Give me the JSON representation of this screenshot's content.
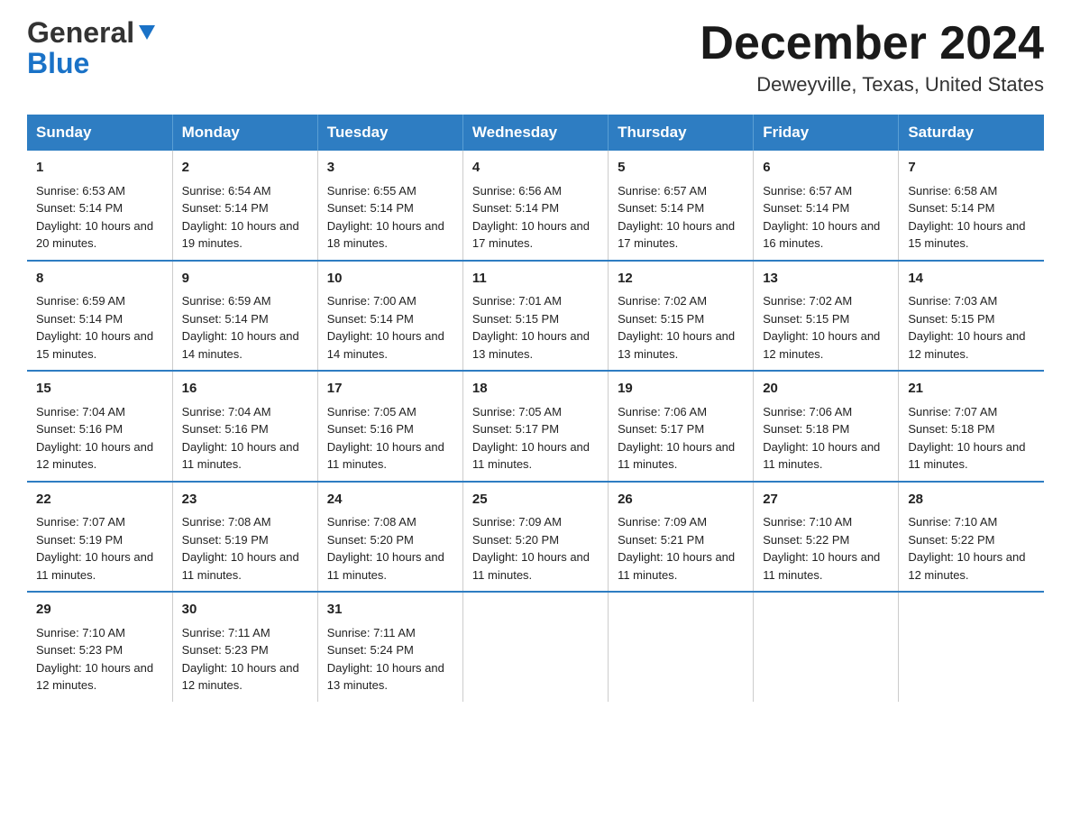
{
  "header": {
    "logo_general": "General",
    "logo_blue": "Blue",
    "title": "December 2024",
    "subtitle": "Deweyville, Texas, United States"
  },
  "days_of_week": [
    "Sunday",
    "Monday",
    "Tuesday",
    "Wednesday",
    "Thursday",
    "Friday",
    "Saturday"
  ],
  "weeks": [
    [
      {
        "day": "1",
        "sunrise": "6:53 AM",
        "sunset": "5:14 PM",
        "daylight": "10 hours and 20 minutes."
      },
      {
        "day": "2",
        "sunrise": "6:54 AM",
        "sunset": "5:14 PM",
        "daylight": "10 hours and 19 minutes."
      },
      {
        "day": "3",
        "sunrise": "6:55 AM",
        "sunset": "5:14 PM",
        "daylight": "10 hours and 18 minutes."
      },
      {
        "day": "4",
        "sunrise": "6:56 AM",
        "sunset": "5:14 PM",
        "daylight": "10 hours and 17 minutes."
      },
      {
        "day": "5",
        "sunrise": "6:57 AM",
        "sunset": "5:14 PM",
        "daylight": "10 hours and 17 minutes."
      },
      {
        "day": "6",
        "sunrise": "6:57 AM",
        "sunset": "5:14 PM",
        "daylight": "10 hours and 16 minutes."
      },
      {
        "day": "7",
        "sunrise": "6:58 AM",
        "sunset": "5:14 PM",
        "daylight": "10 hours and 15 minutes."
      }
    ],
    [
      {
        "day": "8",
        "sunrise": "6:59 AM",
        "sunset": "5:14 PM",
        "daylight": "10 hours and 15 minutes."
      },
      {
        "day": "9",
        "sunrise": "6:59 AM",
        "sunset": "5:14 PM",
        "daylight": "10 hours and 14 minutes."
      },
      {
        "day": "10",
        "sunrise": "7:00 AM",
        "sunset": "5:14 PM",
        "daylight": "10 hours and 14 minutes."
      },
      {
        "day": "11",
        "sunrise": "7:01 AM",
        "sunset": "5:15 PM",
        "daylight": "10 hours and 13 minutes."
      },
      {
        "day": "12",
        "sunrise": "7:02 AM",
        "sunset": "5:15 PM",
        "daylight": "10 hours and 13 minutes."
      },
      {
        "day": "13",
        "sunrise": "7:02 AM",
        "sunset": "5:15 PM",
        "daylight": "10 hours and 12 minutes."
      },
      {
        "day": "14",
        "sunrise": "7:03 AM",
        "sunset": "5:15 PM",
        "daylight": "10 hours and 12 minutes."
      }
    ],
    [
      {
        "day": "15",
        "sunrise": "7:04 AM",
        "sunset": "5:16 PM",
        "daylight": "10 hours and 12 minutes."
      },
      {
        "day": "16",
        "sunrise": "7:04 AM",
        "sunset": "5:16 PM",
        "daylight": "10 hours and 11 minutes."
      },
      {
        "day": "17",
        "sunrise": "7:05 AM",
        "sunset": "5:16 PM",
        "daylight": "10 hours and 11 minutes."
      },
      {
        "day": "18",
        "sunrise": "7:05 AM",
        "sunset": "5:17 PM",
        "daylight": "10 hours and 11 minutes."
      },
      {
        "day": "19",
        "sunrise": "7:06 AM",
        "sunset": "5:17 PM",
        "daylight": "10 hours and 11 minutes."
      },
      {
        "day": "20",
        "sunrise": "7:06 AM",
        "sunset": "5:18 PM",
        "daylight": "10 hours and 11 minutes."
      },
      {
        "day": "21",
        "sunrise": "7:07 AM",
        "sunset": "5:18 PM",
        "daylight": "10 hours and 11 minutes."
      }
    ],
    [
      {
        "day": "22",
        "sunrise": "7:07 AM",
        "sunset": "5:19 PM",
        "daylight": "10 hours and 11 minutes."
      },
      {
        "day": "23",
        "sunrise": "7:08 AM",
        "sunset": "5:19 PM",
        "daylight": "10 hours and 11 minutes."
      },
      {
        "day": "24",
        "sunrise": "7:08 AM",
        "sunset": "5:20 PM",
        "daylight": "10 hours and 11 minutes."
      },
      {
        "day": "25",
        "sunrise": "7:09 AM",
        "sunset": "5:20 PM",
        "daylight": "10 hours and 11 minutes."
      },
      {
        "day": "26",
        "sunrise": "7:09 AM",
        "sunset": "5:21 PM",
        "daylight": "10 hours and 11 minutes."
      },
      {
        "day": "27",
        "sunrise": "7:10 AM",
        "sunset": "5:22 PM",
        "daylight": "10 hours and 11 minutes."
      },
      {
        "day": "28",
        "sunrise": "7:10 AM",
        "sunset": "5:22 PM",
        "daylight": "10 hours and 12 minutes."
      }
    ],
    [
      {
        "day": "29",
        "sunrise": "7:10 AM",
        "sunset": "5:23 PM",
        "daylight": "10 hours and 12 minutes."
      },
      {
        "day": "30",
        "sunrise": "7:11 AM",
        "sunset": "5:23 PM",
        "daylight": "10 hours and 12 minutes."
      },
      {
        "day": "31",
        "sunrise": "7:11 AM",
        "sunset": "5:24 PM",
        "daylight": "10 hours and 13 minutes."
      },
      {
        "day": "",
        "sunrise": "",
        "sunset": "",
        "daylight": ""
      },
      {
        "day": "",
        "sunrise": "",
        "sunset": "",
        "daylight": ""
      },
      {
        "day": "",
        "sunrise": "",
        "sunset": "",
        "daylight": ""
      },
      {
        "day": "",
        "sunrise": "",
        "sunset": "",
        "daylight": ""
      }
    ]
  ],
  "labels": {
    "sunrise": "Sunrise:",
    "sunset": "Sunset:",
    "daylight": "Daylight:"
  }
}
